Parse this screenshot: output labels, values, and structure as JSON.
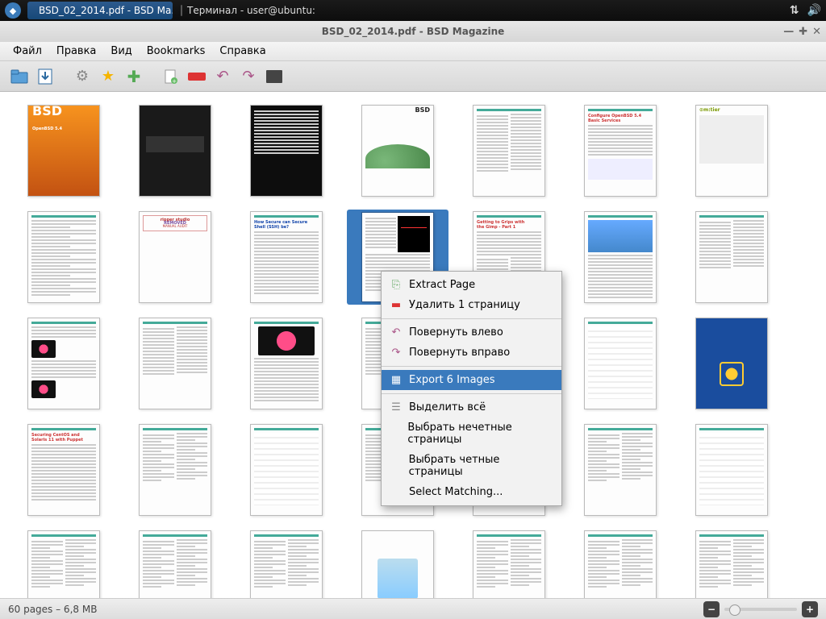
{
  "system": {
    "task_pdf": "BSD_02_2014.pdf - BSD Ma...",
    "task_term": "Терминал - user@ubuntu: ~",
    "net_icon": "↑↓",
    "vol_icon": "🔊"
  },
  "window": {
    "title": "BSD_02_2014.pdf - BSD Magazine"
  },
  "menu": {
    "file": "Файл",
    "edit": "Правка",
    "view": "Вид",
    "bookmarks": "Bookmarks",
    "help": "Справка"
  },
  "status": {
    "text": "60 pages – 6,8 MB"
  },
  "ctx": {
    "extract": "Extract Page",
    "delete": "Удалить 1 страницу",
    "rotl": "Повернуть влево",
    "rotr": "Повернуть вправо",
    "export": "Export 6 Images",
    "selall": "Выделить всё",
    "selodd": "Выбрать нечетные страницы",
    "seleven": "Выбрать четные страницы",
    "selmatch": "Select Matching..."
  },
  "thumb_text": {
    "cover_bsd": "BSD",
    "cover_sub": "OpenBSD 5.4",
    "p6_l1": "Configure OpenBSD 5.4",
    "p6_l2": "Basic Services",
    "p7_brand": "⊙m:tier",
    "p11_l1": "How Secure can Secure",
    "p11_l2": "Shell (SSH) be?",
    "p13_l1": "Getting to Grips with",
    "p13_l2": "the Gimp - Part 1",
    "p22_l1": "Securing CentOS and",
    "p22_l2": "Solaris 11 with Puppet",
    "ripper1": "ripper studio",
    "ripper2": "REMOVED",
    "ripper3": "MANUAL AUDIT"
  }
}
